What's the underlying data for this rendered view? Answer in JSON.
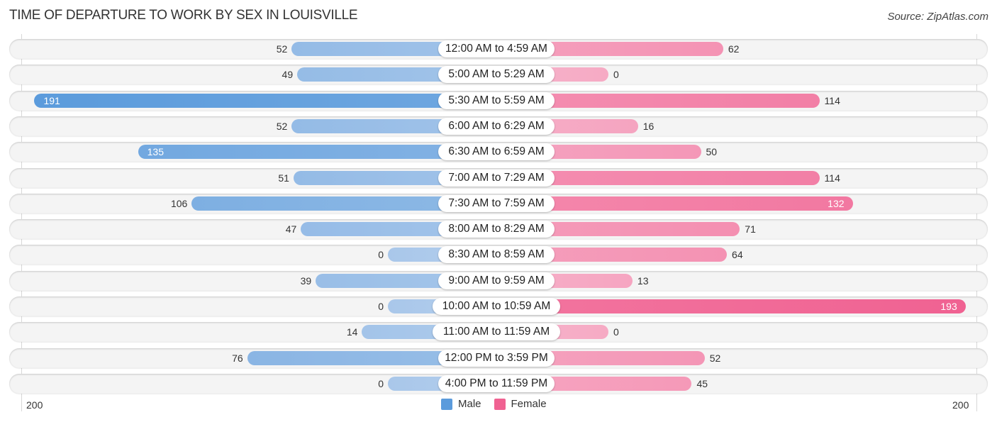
{
  "header": {
    "title": "TIME OF DEPARTURE TO WORK BY SEX IN LOUISVILLE",
    "source": "Source: ZipAtlas.com"
  },
  "colors": {
    "male_light": "#a9c7ea",
    "male_dark": "#5b9bdc",
    "female_light": "#f6aac4",
    "female_dark": "#f06292",
    "row_bg": "#f4f4f4"
  },
  "chart_data": {
    "type": "bar",
    "orientation": "horizontal-diverging",
    "title": "TIME OF DEPARTURE TO WORK BY SEX IN LOUISVILLE",
    "categories": [
      "12:00 AM to 4:59 AM",
      "5:00 AM to 5:29 AM",
      "5:30 AM to 5:59 AM",
      "6:00 AM to 6:29 AM",
      "6:30 AM to 6:59 AM",
      "7:00 AM to 7:29 AM",
      "7:30 AM to 7:59 AM",
      "8:00 AM to 8:29 AM",
      "8:30 AM to 8:59 AM",
      "9:00 AM to 9:59 AM",
      "10:00 AM to 10:59 AM",
      "11:00 AM to 11:59 AM",
      "12:00 PM to 3:59 PM",
      "4:00 PM to 11:59 PM"
    ],
    "series": [
      {
        "name": "Male",
        "side": "left",
        "values": [
          52,
          49,
          191,
          52,
          135,
          51,
          106,
          47,
          0,
          39,
          0,
          14,
          76,
          0
        ]
      },
      {
        "name": "Female",
        "side": "right",
        "values": [
          62,
          0,
          114,
          16,
          50,
          114,
          132,
          71,
          64,
          13,
          193,
          0,
          52,
          45
        ]
      }
    ],
    "axis": {
      "left_tick": "200",
      "right_tick": "200",
      "xlim": [
        0,
        200
      ]
    },
    "legend": {
      "position": "bottom-center",
      "entries": [
        "Male",
        "Female"
      ]
    },
    "xlabel": "",
    "ylabel": "",
    "grid": false
  }
}
